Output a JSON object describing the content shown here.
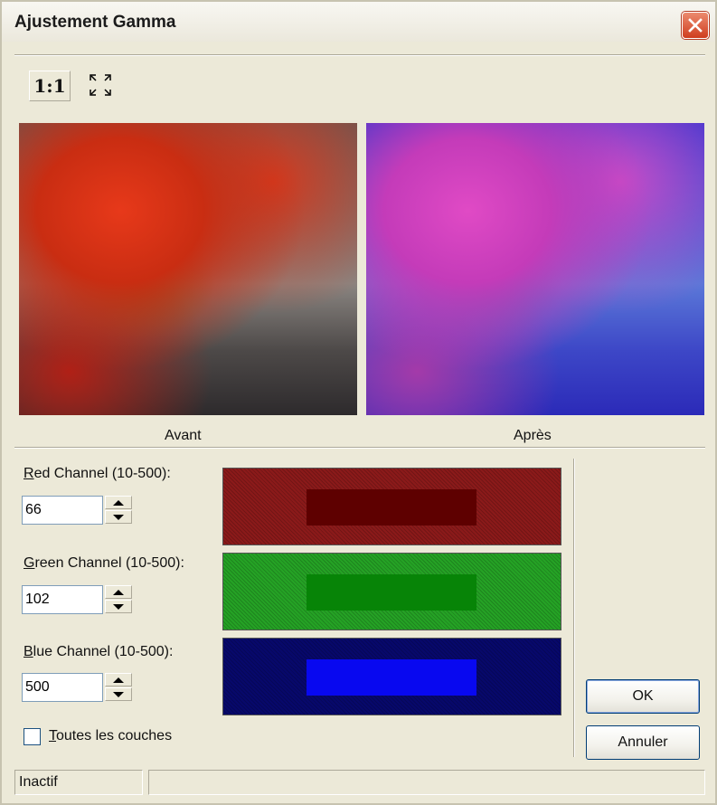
{
  "window": {
    "title": "Ajustement Gamma"
  },
  "toolbar": {
    "zoom_label": "1:1"
  },
  "preview": {
    "before_caption": "Avant",
    "after_caption": "Après"
  },
  "channels": [
    {
      "label_key": "R",
      "label_rest": "ed Channel (10-500):",
      "value": "66",
      "outer_color": "#8b1a1a",
      "inner_color": "#5e0000"
    },
    {
      "label_key": "G",
      "label_rest": "reen Channel (10-500):",
      "value": "102",
      "outer_color": "#25a225",
      "inner_color": "#078407"
    },
    {
      "label_key": "B",
      "label_rest": "lue Channel (10-500):",
      "value": "500",
      "outer_color": "#07086b",
      "inner_color": "#0808f0"
    }
  ],
  "all_layers": {
    "key": "T",
    "label_rest": "outes les couches",
    "checked": false
  },
  "buttons": {
    "ok": "OK",
    "cancel": "Annuler"
  },
  "status": {
    "text": "Inactif",
    "detail": ""
  }
}
